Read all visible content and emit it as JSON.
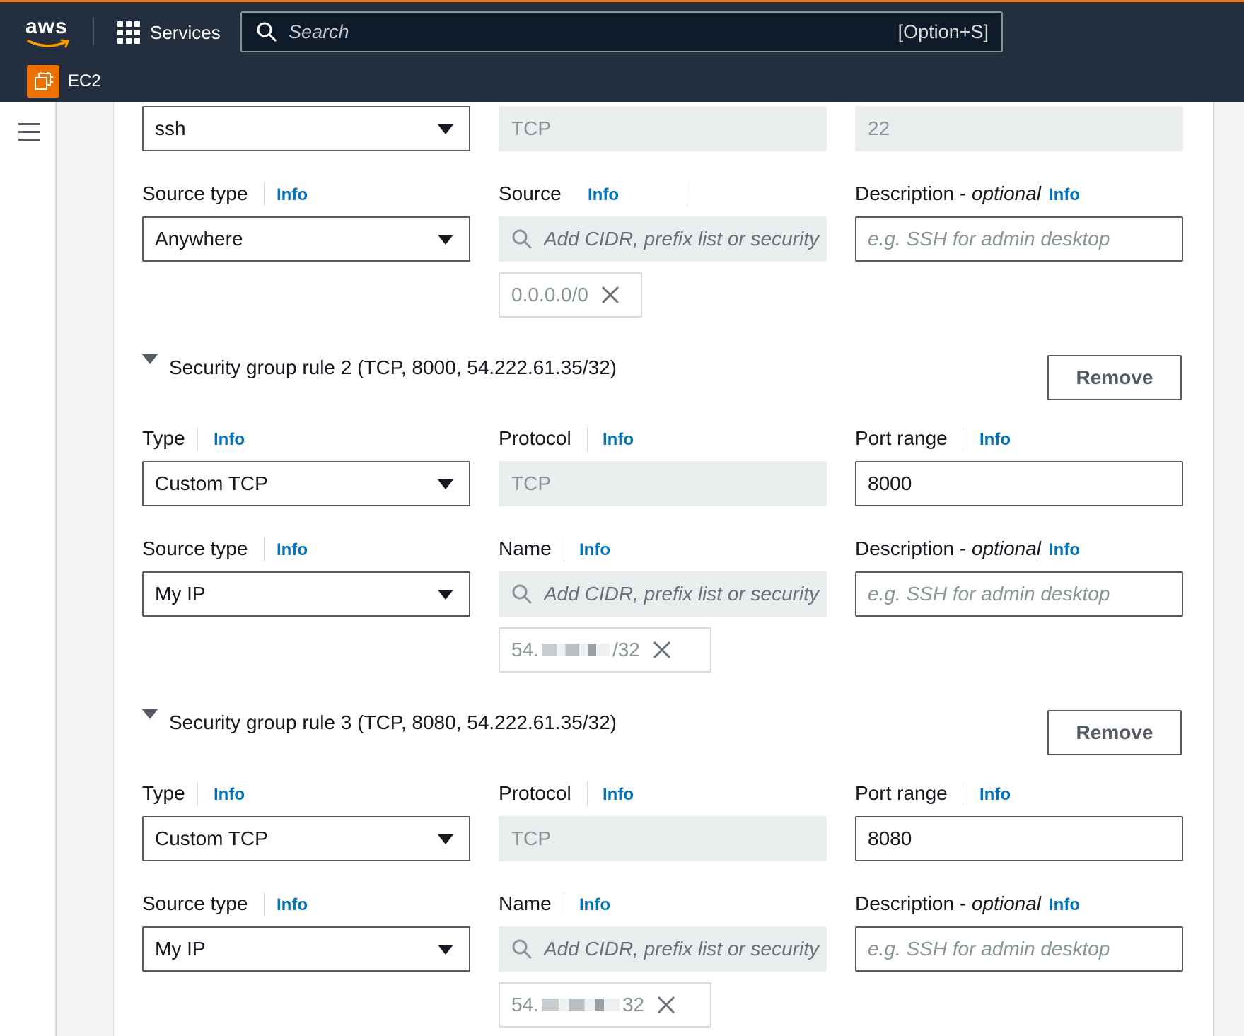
{
  "topbar": {
    "logo_text": "aws",
    "services_label": "Services",
    "search_placeholder": "Search",
    "search_shortcut": "[Option+S]",
    "service_name": "EC2"
  },
  "rule1": {
    "type_value": "ssh",
    "protocol_value": "TCP",
    "port_value": "22",
    "source_type_label": "Source type",
    "source_type_value": "Anywhere",
    "source_label": "Source",
    "source_placeholder": "Add CIDR, prefix list or security",
    "source_token": "0.0.0.0/0",
    "description_label": "Description - ",
    "description_optional": "optional",
    "description_placeholder": "e.g. SSH for admin desktop"
  },
  "rule2": {
    "header": "Security group rule 2 (TCP, 8000, 54.222.61.35/32)",
    "remove_label": "Remove",
    "type_label": "Type",
    "type_value": "Custom TCP",
    "protocol_label": "Protocol",
    "protocol_value": "TCP",
    "port_label": "Port range",
    "port_value": "8000",
    "source_type_label": "Source type",
    "source_type_value": "My IP",
    "name_label": "Name",
    "source_placeholder": "Add CIDR, prefix list or security",
    "source_token_prefix": "54.",
    "source_token_suffix": "/32",
    "description_label": "Description - ",
    "description_optional": "optional",
    "description_placeholder": "e.g. SSH for admin desktop"
  },
  "rule3": {
    "header": "Security group rule 3 (TCP, 8080, 54.222.61.35/32)",
    "remove_label": "Remove",
    "type_label": "Type",
    "type_value": "Custom TCP",
    "protocol_label": "Protocol",
    "protocol_value": "TCP",
    "port_label": "Port range",
    "port_value": "8080",
    "source_type_label": "Source type",
    "source_type_value": "My IP",
    "name_label": "Name",
    "source_placeholder": "Add CIDR, prefix list or security",
    "source_token_prefix": "54.",
    "source_token_suffix": "32",
    "description_label": "Description - ",
    "description_optional": "optional",
    "description_placeholder": "e.g. SSH for admin desktop"
  },
  "info_link": "Info",
  "icons": {
    "menu": "hamburger-menu-icon",
    "services": "grid-icon",
    "search": "search-icon",
    "service": "ec2-icon",
    "remove_token": "close-icon",
    "dropdown": "caret-down-icon",
    "expand": "triangle-down-icon"
  },
  "colors": {
    "nav_bg": "#232f3e",
    "accent": "#ec7211",
    "link": "#0073bb",
    "disabled_bg": "#eaeded"
  }
}
